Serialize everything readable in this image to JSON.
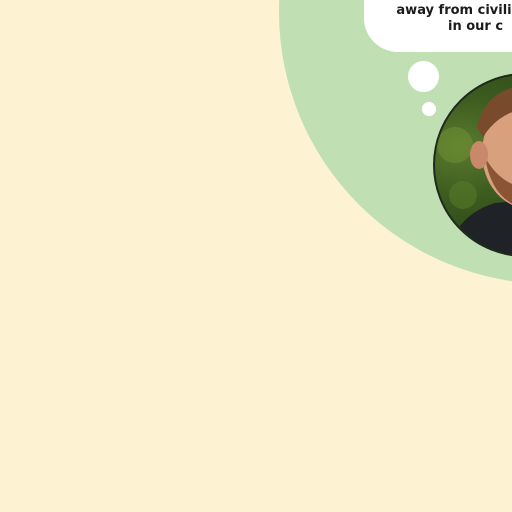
{
  "speech_bubble": {
    "line1": "away from civilizatio",
    "line2": "in our c"
  },
  "avatar": {
    "icon": "person-photo",
    "alt": ""
  },
  "colors": {
    "background": "#fdf2d1",
    "blob": "#c0e0b3",
    "bubble": "#ffffff"
  }
}
